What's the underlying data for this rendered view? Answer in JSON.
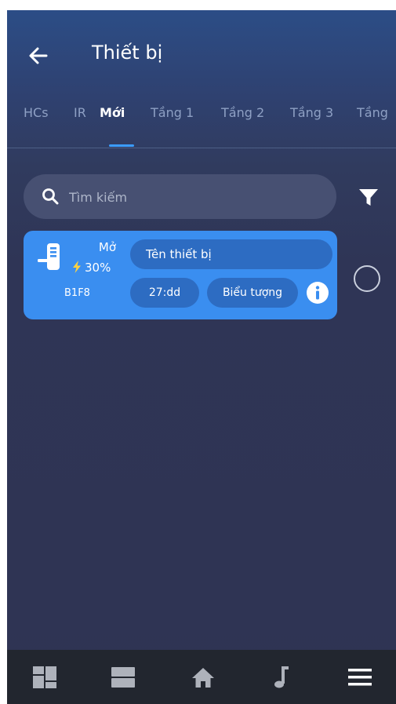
{
  "header": {
    "title": "Thiết bị",
    "back_icon": "arrow-left-icon"
  },
  "tabs": [
    {
      "label": "HCs",
      "active": false
    },
    {
      "label": "IR",
      "active": false
    },
    {
      "label": "Mới",
      "active": true
    },
    {
      "label": "Tầng 1",
      "active": false
    },
    {
      "label": "Tầng 2",
      "active": false
    },
    {
      "label": "Tầng 3",
      "active": false
    },
    {
      "label": "Tầng",
      "active": false
    }
  ],
  "search": {
    "placeholder": "Tìm kiếm",
    "value": ""
  },
  "filter_icon": "filter-icon",
  "device": {
    "status": "Mở",
    "battery": "30%",
    "id": "B1F8",
    "name_placeholder": "Tên thiết bị",
    "time_label": "27:dd",
    "icon_label": "Biểu tượng",
    "selected": false
  },
  "bottom_nav": [
    {
      "icon": "dashboard-icon"
    },
    {
      "icon": "list-icon"
    },
    {
      "icon": "home-icon"
    },
    {
      "icon": "music-note-icon"
    },
    {
      "icon": "menu-icon"
    }
  ],
  "colors": {
    "accent": "#3b9cff",
    "card": "#3a8ef0",
    "pill": "#2d6cc2",
    "battery_bolt": "#ffd23f",
    "nav_bg": "#22262f"
  }
}
